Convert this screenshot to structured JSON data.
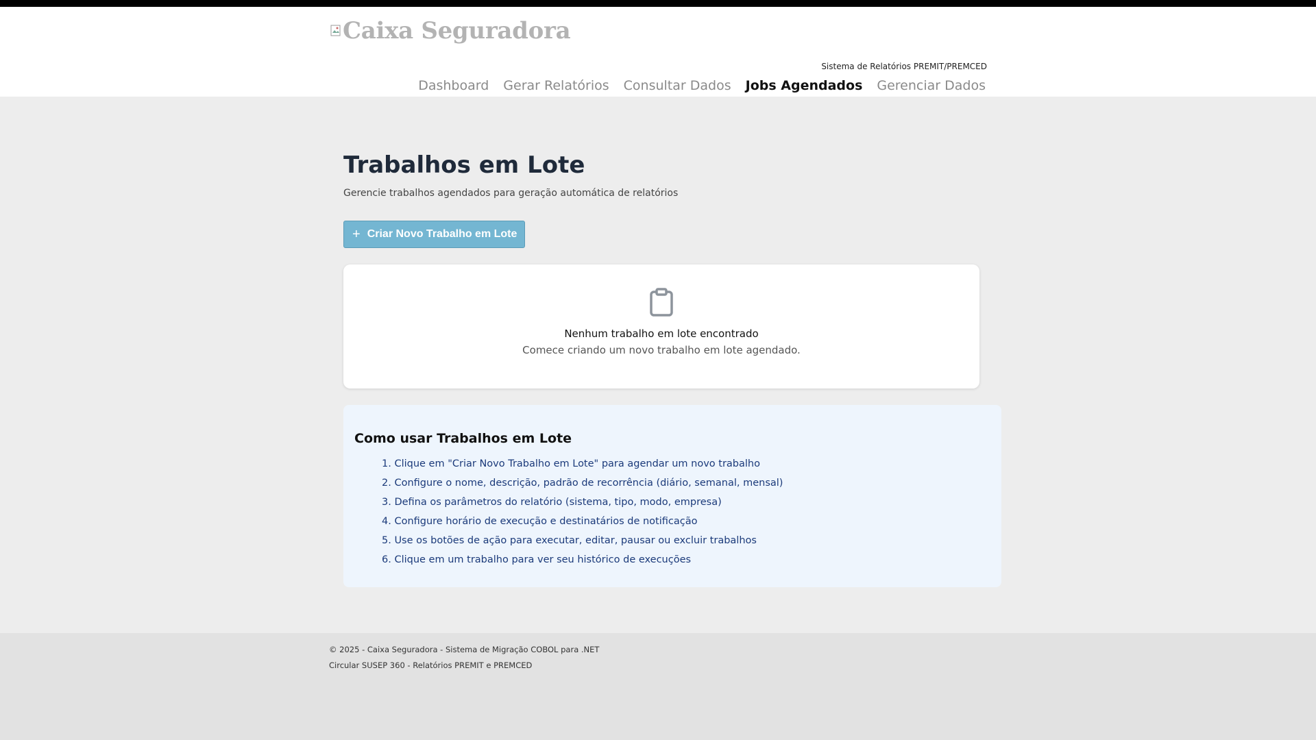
{
  "header": {
    "logo_text": "Caixa Seguradora",
    "subtitle": "Sistema de Relatórios PREMIT/PREMCED",
    "nav": [
      {
        "label": "Dashboard",
        "active": false
      },
      {
        "label": "Gerar Relatórios",
        "active": false
      },
      {
        "label": "Consultar Dados",
        "active": false
      },
      {
        "label": "Jobs Agendados",
        "active": true
      },
      {
        "label": "Gerenciar Dados",
        "active": false
      }
    ]
  },
  "main": {
    "title": "Trabalhos em Lote",
    "description": "Gerencie trabalhos agendados para geração automática de relatórios",
    "create_button": {
      "icon": "plus-icon",
      "label": "Criar Novo Trabalho em Lote"
    },
    "empty_state": {
      "icon": "clipboard-icon",
      "title": "Nenhum trabalho em lote encontrado",
      "subtitle": "Comece criando um novo trabalho em lote agendado."
    },
    "howto": {
      "title": "Como usar Trabalhos em Lote",
      "steps": [
        "1. Clique em \"Criar Novo Trabalho em Lote\" para agendar um novo trabalho",
        "2. Configure o nome, descrição, padrão de recorrência (diário, semanal, mensal)",
        "3. Defina os parâmetros do relatório (sistema, tipo, modo, empresa)",
        "4. Configure horário de execução e destinatários de notificação",
        "5. Use os botões de ação para executar, editar, pausar ou excluir trabalhos",
        "6. Clique em um trabalho para ver seu histórico de execuções"
      ]
    }
  },
  "footer": {
    "line1": "© 2025 - Caixa Seguradora - Sistema de Migração COBOL para .NET",
    "line2": "Circular SUSEP 360 - Relatórios PREMIT e PREMCED"
  },
  "colors": {
    "button_bg": "#74b6d2",
    "howto_bg": "#eef5fd",
    "title": "#1f2a3a",
    "howto_text": "#1b3a7a"
  }
}
